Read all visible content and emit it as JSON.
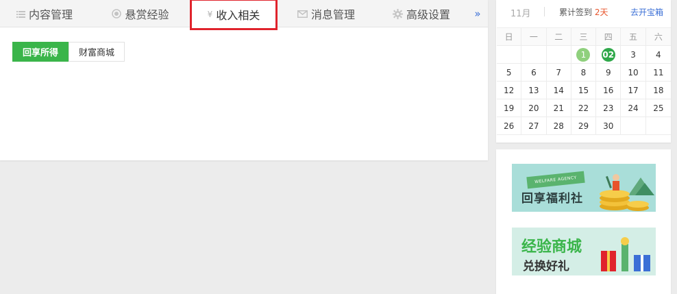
{
  "tabs": [
    {
      "label": "内容管理",
      "icon": "list-icon"
    },
    {
      "label": "悬赏经验",
      "icon": "coin-icon"
    },
    {
      "label": "收入相关",
      "icon": "yen-icon"
    },
    {
      "label": "消息管理",
      "icon": "mail-icon"
    },
    {
      "label": "高级设置",
      "icon": "gear-icon"
    }
  ],
  "more_label": "»",
  "subtabs": [
    "回享所得",
    "财富商城"
  ],
  "calendar": {
    "month": "11月",
    "streak_prefix": "累计签到",
    "streak_days": "2天",
    "treasure_link": "去开宝箱",
    "weekdays": [
      "日",
      "一",
      "二",
      "三",
      "四",
      "五",
      "六"
    ],
    "weeks": [
      [
        "",
        "",
        "",
        "1",
        "02",
        "3",
        "4"
      ],
      [
        "5",
        "6",
        "7",
        "8",
        "9",
        "10",
        "11"
      ],
      [
        "12",
        "13",
        "14",
        "15",
        "16",
        "17",
        "18"
      ],
      [
        "19",
        "20",
        "21",
        "22",
        "23",
        "24",
        "25"
      ],
      [
        "26",
        "27",
        "28",
        "29",
        "30",
        "",
        ""
      ]
    ],
    "signed_days": [
      "1"
    ],
    "today": "02"
  },
  "banners": {
    "first_ribbon": "WELFARE AGENCY",
    "first_title": "回享福利社",
    "second_title_top": "经验商城",
    "second_title_bottom": "兑换好礼"
  },
  "colors": {
    "accent_green": "#3ab54a",
    "highlight_red": "#e0232c",
    "link_blue": "#3b6fd6",
    "streak_orange": "#e8542b"
  }
}
